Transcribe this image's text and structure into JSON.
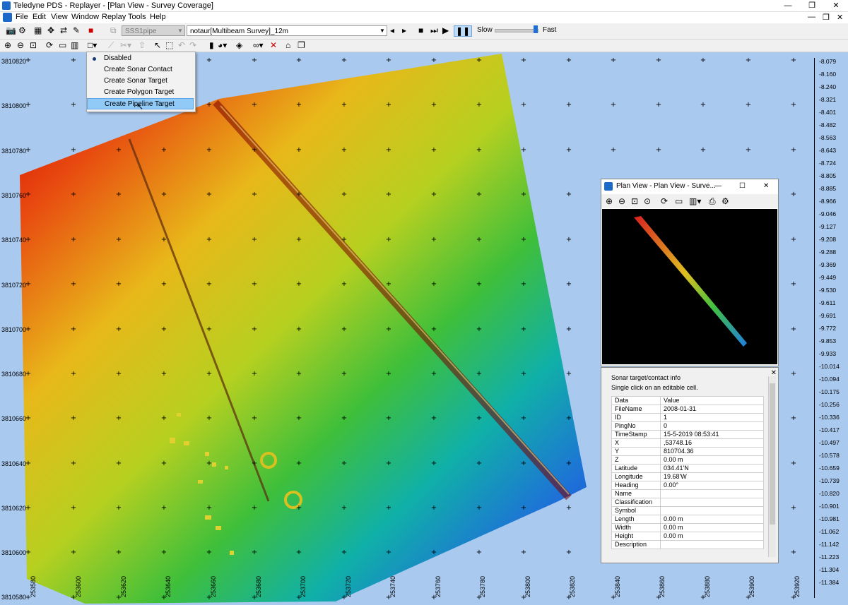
{
  "window": {
    "title": "Teledyne PDS - Replayer - [Plan View - Survey Coverage]",
    "min": "—",
    "max": "❐",
    "close": "✕"
  },
  "menu": [
    "File",
    "Edit",
    "View",
    "Window",
    "Replay",
    "Tools",
    "Help"
  ],
  "mdi_buttons": {
    "min": "—",
    "restore": "❐",
    "close": "✕"
  },
  "toolbar": {
    "source_combo": "SSS1pipe",
    "survey_combo": "notaur[Multibeam Survey]_12m",
    "slow_label": "Slow",
    "fast_label": "Fast",
    "speed": 0.92
  },
  "dropdown": {
    "items": [
      "Disabled",
      "Create Sonar Contact",
      "Create Sonar Target",
      "Create Polygon Target",
      "Create Pipeline Target"
    ],
    "checked_index": 0,
    "highlight_index": 4
  },
  "map": {
    "y_labels": [
      "3810820",
      "3810800",
      "3810780",
      "3810760",
      "3810740",
      "3810720",
      "3810700",
      "3810680",
      "3810660",
      "3810640",
      "3810620",
      "3810600",
      "3810580"
    ],
    "x_labels": [
      "253580",
      "253600",
      "253620",
      "253640",
      "253660",
      "253680",
      "253700",
      "253720",
      "253740",
      "253760",
      "253780",
      "253800",
      "253820",
      "253840",
      "253860",
      "253880",
      "253900",
      "253920"
    ],
    "legend": [
      "-8.079",
      "-8.160",
      "-8.240",
      "-8.321",
      "-8.401",
      "-8.482",
      "-8.563",
      "-8.643",
      "-8.724",
      "-8.805",
      "-8.885",
      "-8.966",
      "-9.046",
      "-9.127",
      "-9.208",
      "-9.288",
      "-9.369",
      "-9.449",
      "-9.530",
      "-9.611",
      "-9.691",
      "-9.772",
      "-9.853",
      "-9.933",
      "-10.014",
      "-10.094",
      "-10.175",
      "-10.256",
      "-10.336",
      "-10.417",
      "-10.497",
      "-10.578",
      "-10.659",
      "-10.739",
      "-10.820",
      "-10.901",
      "-10.981",
      "-11.062",
      "-11.142",
      "-11.223",
      "-11.304",
      "-11.384"
    ]
  },
  "subwindow": {
    "title": "Plan View - Plan View - Surve...",
    "min": "—",
    "max": "☐",
    "close": "✕"
  },
  "info": {
    "header": "Sonar target/contact info",
    "hint": "Single click on an editable cell.",
    "columns": [
      "Data",
      "Value"
    ],
    "rows": [
      [
        "FileName",
        "2008-01-31"
      ],
      [
        "ID",
        "1"
      ],
      [
        "PingNo",
        "0"
      ],
      [
        "TimeStamp",
        "15-5-2019 08:53:41"
      ],
      [
        "X",
        ",53748.16"
      ],
      [
        "Y",
        "810704.36"
      ],
      [
        "Z",
        "0.00 m"
      ],
      [
        "Latitude",
        "034.41'N"
      ],
      [
        "Longitude",
        "19.68'W"
      ],
      [
        "Heading",
        "0.00°"
      ],
      [
        "Name",
        ""
      ],
      [
        "Classification",
        ""
      ],
      [
        "Symbol",
        ""
      ],
      [
        "Length",
        "0.00 m"
      ],
      [
        "Width",
        "0.00 m"
      ],
      [
        "Height",
        "0.00 m"
      ],
      [
        "Description",
        ""
      ]
    ]
  },
  "colors": {
    "background": "#a9c9ef",
    "accent": "#1b6ac9",
    "menu_highlight": "#91c9f7"
  }
}
